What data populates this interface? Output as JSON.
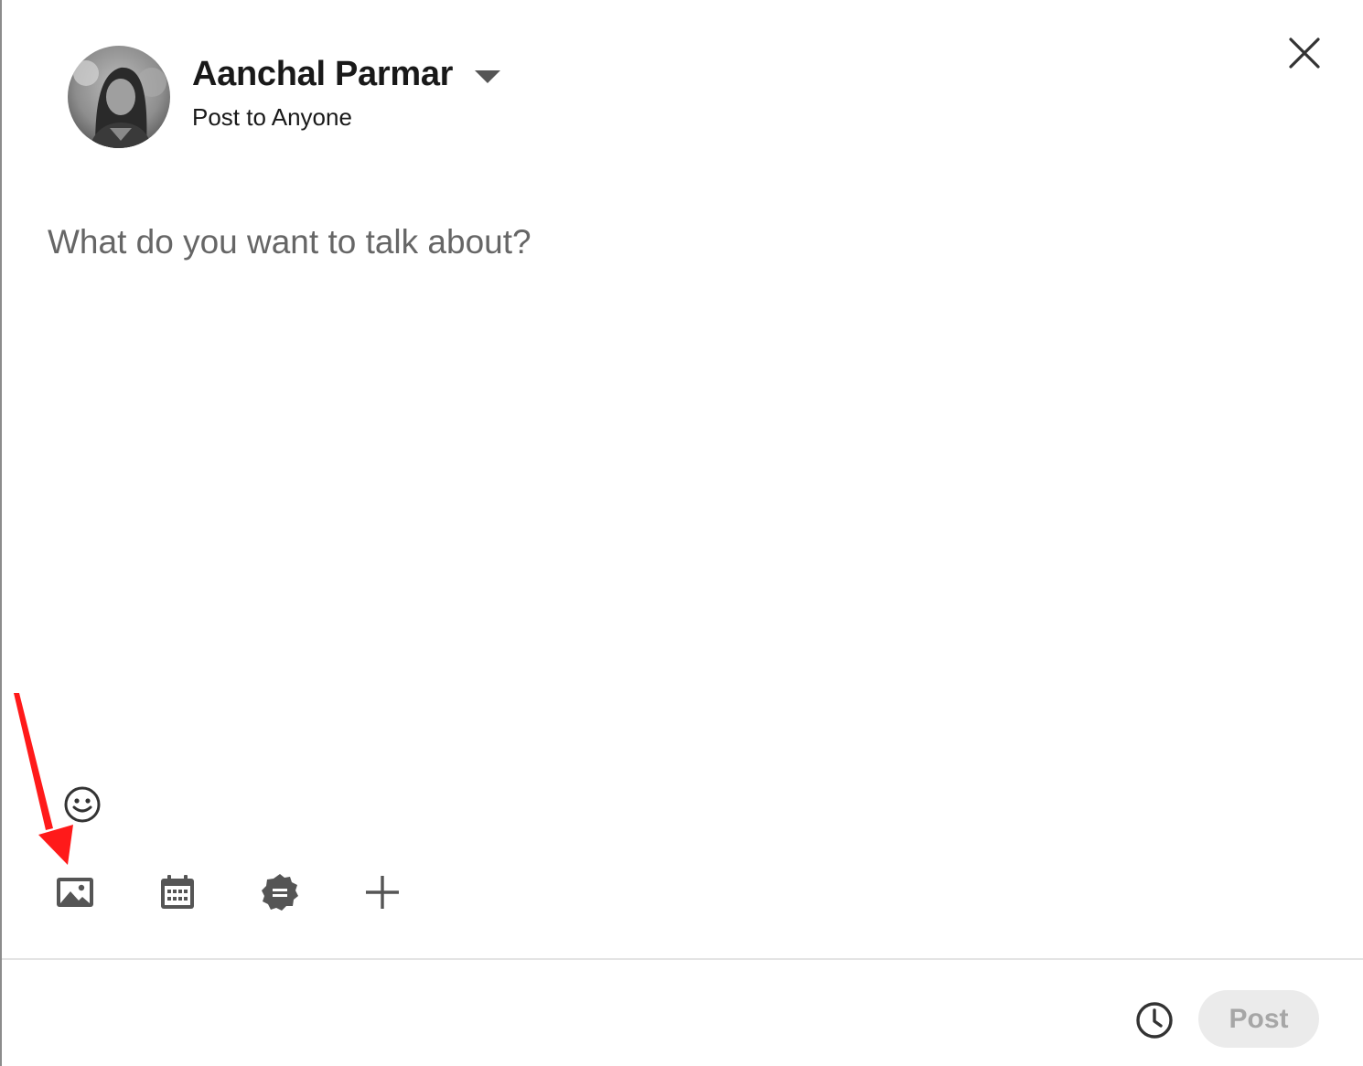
{
  "author": {
    "name": "Aanchal Parmar",
    "audience": "Post to Anyone",
    "avatar_icon": "profile-photo"
  },
  "composer": {
    "placeholder": "What do you want to talk about?",
    "value": ""
  },
  "toolbar": {
    "emoji_icon": "smiley-icon",
    "tools": [
      {
        "name": "add-photo",
        "icon": "image-icon"
      },
      {
        "name": "create-event",
        "icon": "calendar-icon"
      },
      {
        "name": "celebrate-occasion",
        "icon": "badge-icon"
      },
      {
        "name": "more",
        "icon": "plus-icon"
      }
    ]
  },
  "footer": {
    "schedule_icon": "clock-icon",
    "post_label": "Post"
  },
  "colors": {
    "text_primary": "#191919",
    "icon": "#555555",
    "post_button_bg": "#ebebeb",
    "post_button_text": "#a6a6a6",
    "annotation_arrow": "#ff1a1a"
  }
}
